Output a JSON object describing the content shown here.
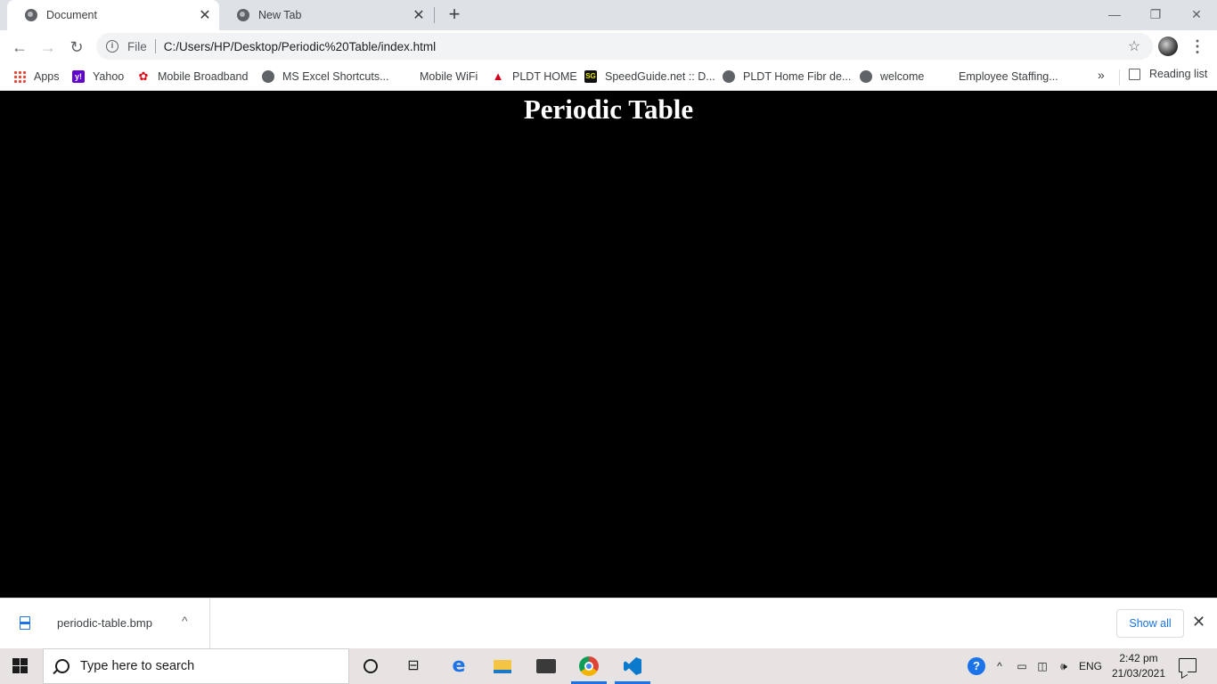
{
  "tabs": [
    {
      "title": "Document",
      "close": "✕"
    },
    {
      "title": "New Tab",
      "close": "✕"
    }
  ],
  "window_controls": {
    "minimize": "—",
    "restore": "❐",
    "close": "✕"
  },
  "new_tab": "+",
  "toolbar": {
    "back": "←",
    "forward": "→",
    "reload": "↻",
    "site_info_label": "File",
    "url": "C:/Users/HP/Desktop/Periodic%20Table/index.html",
    "bookmark_star": "☆",
    "menu": "⋮"
  },
  "bookmarks": [
    {
      "label": "Apps",
      "icon": "apps-grid-icon"
    },
    {
      "label": "Yahoo",
      "icon": "yahoo-icon"
    },
    {
      "label": "Mobile Broadband",
      "icon": "huawei-icon"
    },
    {
      "label": "MS Excel Shortcuts...",
      "icon": "globe-icon"
    },
    {
      "label": "Mobile WiFi",
      "icon": "none"
    },
    {
      "label": "PLDT HOME",
      "icon": "pldt-icon"
    },
    {
      "label": "SpeedGuide.net :: D...",
      "icon": "speedguide-icon"
    },
    {
      "label": "PLDT Home Fibr de...",
      "icon": "globe-icon"
    },
    {
      "label": "welcome",
      "icon": "globe-icon"
    },
    {
      "label": "Employee Staffing...",
      "icon": "none"
    }
  ],
  "bookmarks_more": "»",
  "reading_list": "Reading list",
  "page": {
    "heading": "Periodic Table",
    "background": "#000000",
    "heading_color": "#ffffff"
  },
  "downloads": {
    "file_name": "periodic-table.bmp",
    "chevron": "^",
    "show_all": "Show all",
    "close": "✕"
  },
  "taskbar": {
    "search_placeholder": "Type here to search",
    "language": "ENG",
    "time": "2:42 pm",
    "date": "21/03/2021",
    "help": "?",
    "tray_chevron": "^"
  }
}
